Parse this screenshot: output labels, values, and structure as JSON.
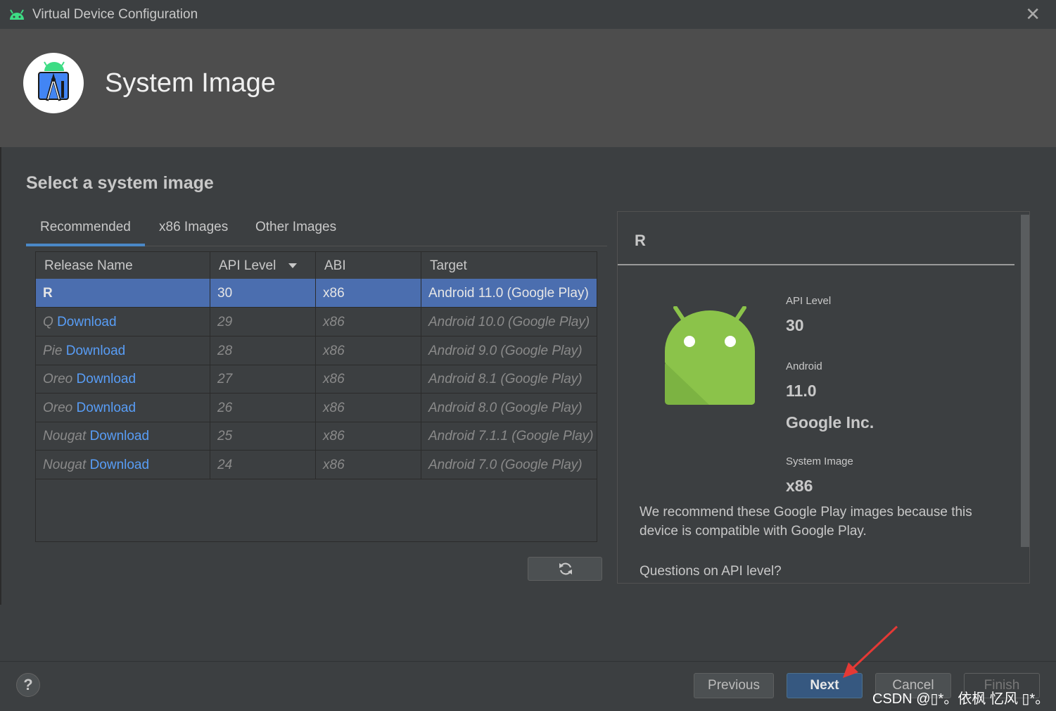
{
  "window": {
    "title": "Virtual Device Configuration"
  },
  "header": {
    "title": "System Image"
  },
  "section_title": "Select a system image",
  "tabs": [
    {
      "label": "Recommended",
      "active": true
    },
    {
      "label": "x86 Images",
      "active": false
    },
    {
      "label": "Other Images",
      "active": false
    }
  ],
  "table": {
    "columns": [
      "Release Name",
      "API Level",
      "ABI",
      "Target"
    ],
    "sort_column": "API Level",
    "rows": [
      {
        "name": "R",
        "download": "",
        "api": "30",
        "abi": "x86",
        "target": "Android 11.0 (Google Play)",
        "selected": true
      },
      {
        "name": "Q",
        "download": "Download",
        "api": "29",
        "abi": "x86",
        "target": "Android 10.0 (Google Play)",
        "selected": false
      },
      {
        "name": "Pie",
        "download": "Download",
        "api": "28",
        "abi": "x86",
        "target": "Android 9.0 (Google Play)",
        "selected": false
      },
      {
        "name": "Oreo",
        "download": "Download",
        "api": "27",
        "abi": "x86",
        "target": "Android 8.1 (Google Play)",
        "selected": false
      },
      {
        "name": "Oreo",
        "download": "Download",
        "api": "26",
        "abi": "x86",
        "target": "Android 8.0 (Google Play)",
        "selected": false
      },
      {
        "name": "Nougat",
        "download": "Download",
        "api": "25",
        "abi": "x86",
        "target": "Android 7.1.1 (Google Play)",
        "selected": false
      },
      {
        "name": "Nougat",
        "download": "Download",
        "api": "24",
        "abi": "x86",
        "target": "Android 7.0 (Google Play)",
        "selected": false
      }
    ]
  },
  "detail": {
    "name": "R",
    "api_level_label": "API Level",
    "api_level": "30",
    "android_label": "Android",
    "android_version": "11.0",
    "vendor": "Google Inc.",
    "system_image_label": "System Image",
    "system_image": "x86",
    "recommendation": "We recommend these Google Play images because this device is compatible with Google Play.",
    "questions_link": "Questions on API level?"
  },
  "footer": {
    "help": "?",
    "previous": "Previous",
    "next": "Next",
    "cancel": "Cancel",
    "finish": "Finish"
  },
  "watermark": "CSDN @▯*。依枫 忆风 ▯*。",
  "colors": {
    "selection": "#4b6eaf",
    "link": "#589df6",
    "primary_button": "#365880",
    "android_green": "#8bc34a",
    "annotation_arrow": "#e53935"
  }
}
